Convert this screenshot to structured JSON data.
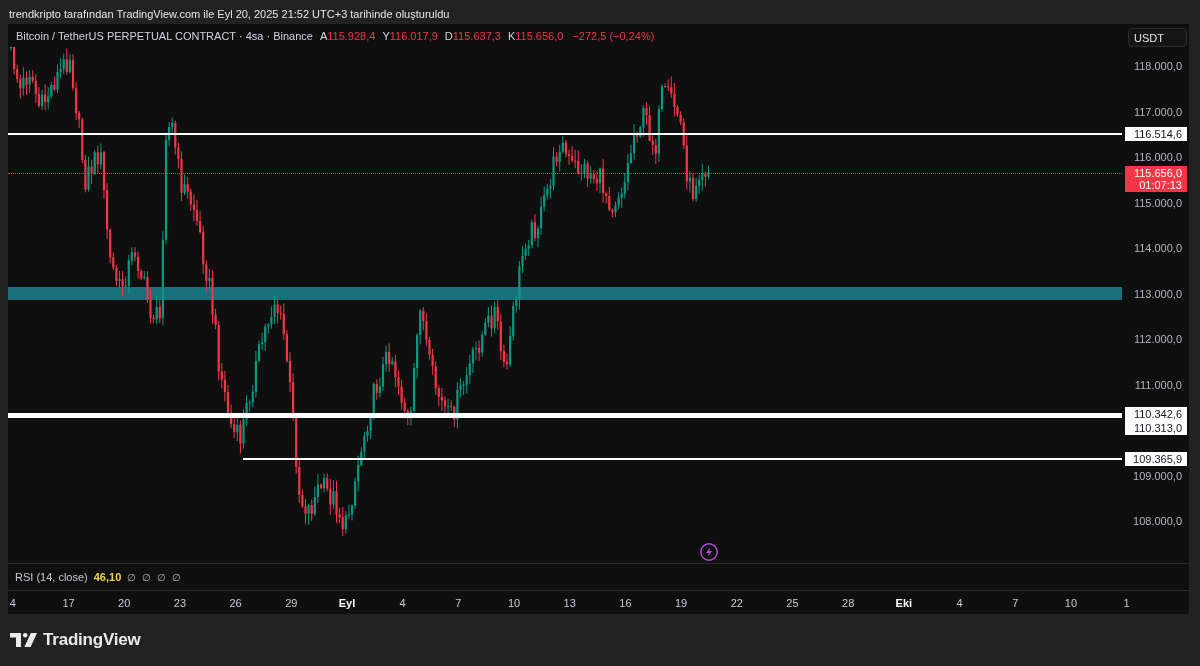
{
  "caption": "trendkripto tarafından TradingView.com ile Eyl 20, 2025 21:52 UTC+3 tarihinde oluşturuldu",
  "legend": {
    "symbol": "Bitcoin / TetherUS PERPETUAL CONTRACT · 4sa · Binance",
    "values": [
      {
        "key": "A",
        "value": "115.928,4"
      },
      {
        "key": "Y",
        "value": "116.017,9"
      },
      {
        "key": "D",
        "value": "115.637,3"
      },
      {
        "key": "K",
        "value": "115.656,0"
      }
    ],
    "change": "−272,5 (−0,24%)"
  },
  "currency_button": "USDT",
  "price_axis": {
    "ticks": [
      "118.000,0",
      "117.000,0",
      "116.000,0",
      "115.000,0",
      "114.000,0",
      "113.000,0",
      "112.000,0",
      "111.000,0",
      "109.000,0",
      "108.000,0"
    ]
  },
  "drawings": [
    {
      "kind": "line",
      "label": "116.514,6"
    },
    {
      "kind": "zone"
    },
    {
      "kind": "line",
      "label": "110.342,6"
    },
    {
      "kind": "line",
      "label": "110.313,0"
    },
    {
      "kind": "ray",
      "label": "109.365,9"
    }
  ],
  "current_price": {
    "price": "115.656,0",
    "countdown": "01:07:13"
  },
  "rsi": {
    "label": "RSI (14, close)",
    "value": "46,10",
    "plot_values": [
      "∅",
      "∅",
      "∅",
      "∅"
    ]
  },
  "time_axis": [
    {
      "label": "4",
      "kind": "day"
    },
    {
      "label": "17",
      "kind": "day"
    },
    {
      "label": "20",
      "kind": "day"
    },
    {
      "label": "23",
      "kind": "day"
    },
    {
      "label": "26",
      "kind": "day"
    },
    {
      "label": "29",
      "kind": "day"
    },
    {
      "label": "Eyl",
      "kind": "month"
    },
    {
      "label": "4",
      "kind": "day"
    },
    {
      "label": "7",
      "kind": "day"
    },
    {
      "label": "10",
      "kind": "day"
    },
    {
      "label": "13",
      "kind": "day"
    },
    {
      "label": "16",
      "kind": "day"
    },
    {
      "label": "19",
      "kind": "day"
    },
    {
      "label": "22",
      "kind": "day"
    },
    {
      "label": "25",
      "kind": "day"
    },
    {
      "label": "28",
      "kind": "day"
    },
    {
      "label": "Eki",
      "kind": "month"
    },
    {
      "label": "4",
      "kind": "day"
    },
    {
      "label": "7",
      "kind": "day"
    },
    {
      "label": "10",
      "kind": "day"
    },
    {
      "label": "1",
      "kind": "day"
    }
  ],
  "brand": "TradingView"
}
